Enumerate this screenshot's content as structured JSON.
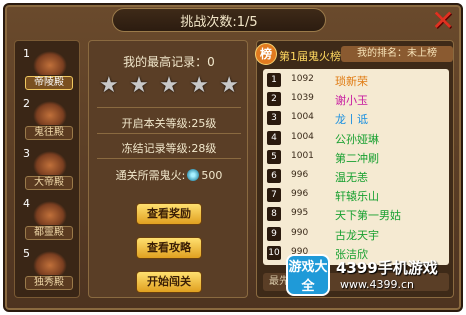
{
  "header": {
    "challenge_count": "挑战次数:1/5"
  },
  "close": {
    "icon": "close-x-icon",
    "color": "#e03020"
  },
  "stages": [
    {
      "num": "1",
      "name": "帝陵殿",
      "active": true
    },
    {
      "num": "2",
      "name": "鬼往殿",
      "active": false
    },
    {
      "num": "3",
      "name": "大帝殿",
      "active": false
    },
    {
      "num": "4",
      "name": "都靈殿",
      "active": false
    },
    {
      "num": "5",
      "name": "独秀殿",
      "active": false
    }
  ],
  "record": {
    "best": "我的最高记录：0",
    "stars_total": 5,
    "stars_filled": 0,
    "open_level": "开启本关等级:25级",
    "freeze_level": "冻结记录等级:28级",
    "fire_label": "通关所需鬼火:",
    "fire_value": "500"
  },
  "buttons": {
    "view_reward": "查看奖励",
    "view_guide": "查看攻略",
    "start": "开始闯关"
  },
  "ranking": {
    "badge": "榜",
    "title": "第1届鬼火榜",
    "my_rank": "我的排名：未上榜",
    "footer": "最先",
    "rows": [
      {
        "no": "1",
        "score": "1092",
        "name": "琐新荣",
        "color": "#e07a10"
      },
      {
        "no": "2",
        "score": "1039",
        "name": "谢小玉",
        "color": "#c81aa0"
      },
      {
        "no": "3",
        "score": "1004",
        "name": "龙丨诋",
        "color": "#1a90e0"
      },
      {
        "no": "4",
        "score": "1004",
        "name": "公孙娅琳",
        "color": "#18a030"
      },
      {
        "no": "5",
        "score": "1001",
        "name": "第二冲刷",
        "color": "#18a030"
      },
      {
        "no": "6",
        "score": "996",
        "name": "温无恙",
        "color": "#18a030"
      },
      {
        "no": "7",
        "score": "996",
        "name": "轩辕乐山",
        "color": "#18a030"
      },
      {
        "no": "8",
        "score": "995",
        "name": "天下第一男姑",
        "color": "#18a030"
      },
      {
        "no": "9",
        "score": "990",
        "name": "古龙天宇",
        "color": "#18a030"
      },
      {
        "no": "10",
        "score": "990",
        "name": "张洁欣",
        "color": "#18a030"
      }
    ]
  },
  "watermark": {
    "logo": "游戏大全",
    "name": "4399手机游戏",
    "url": "www.4399.cn"
  }
}
